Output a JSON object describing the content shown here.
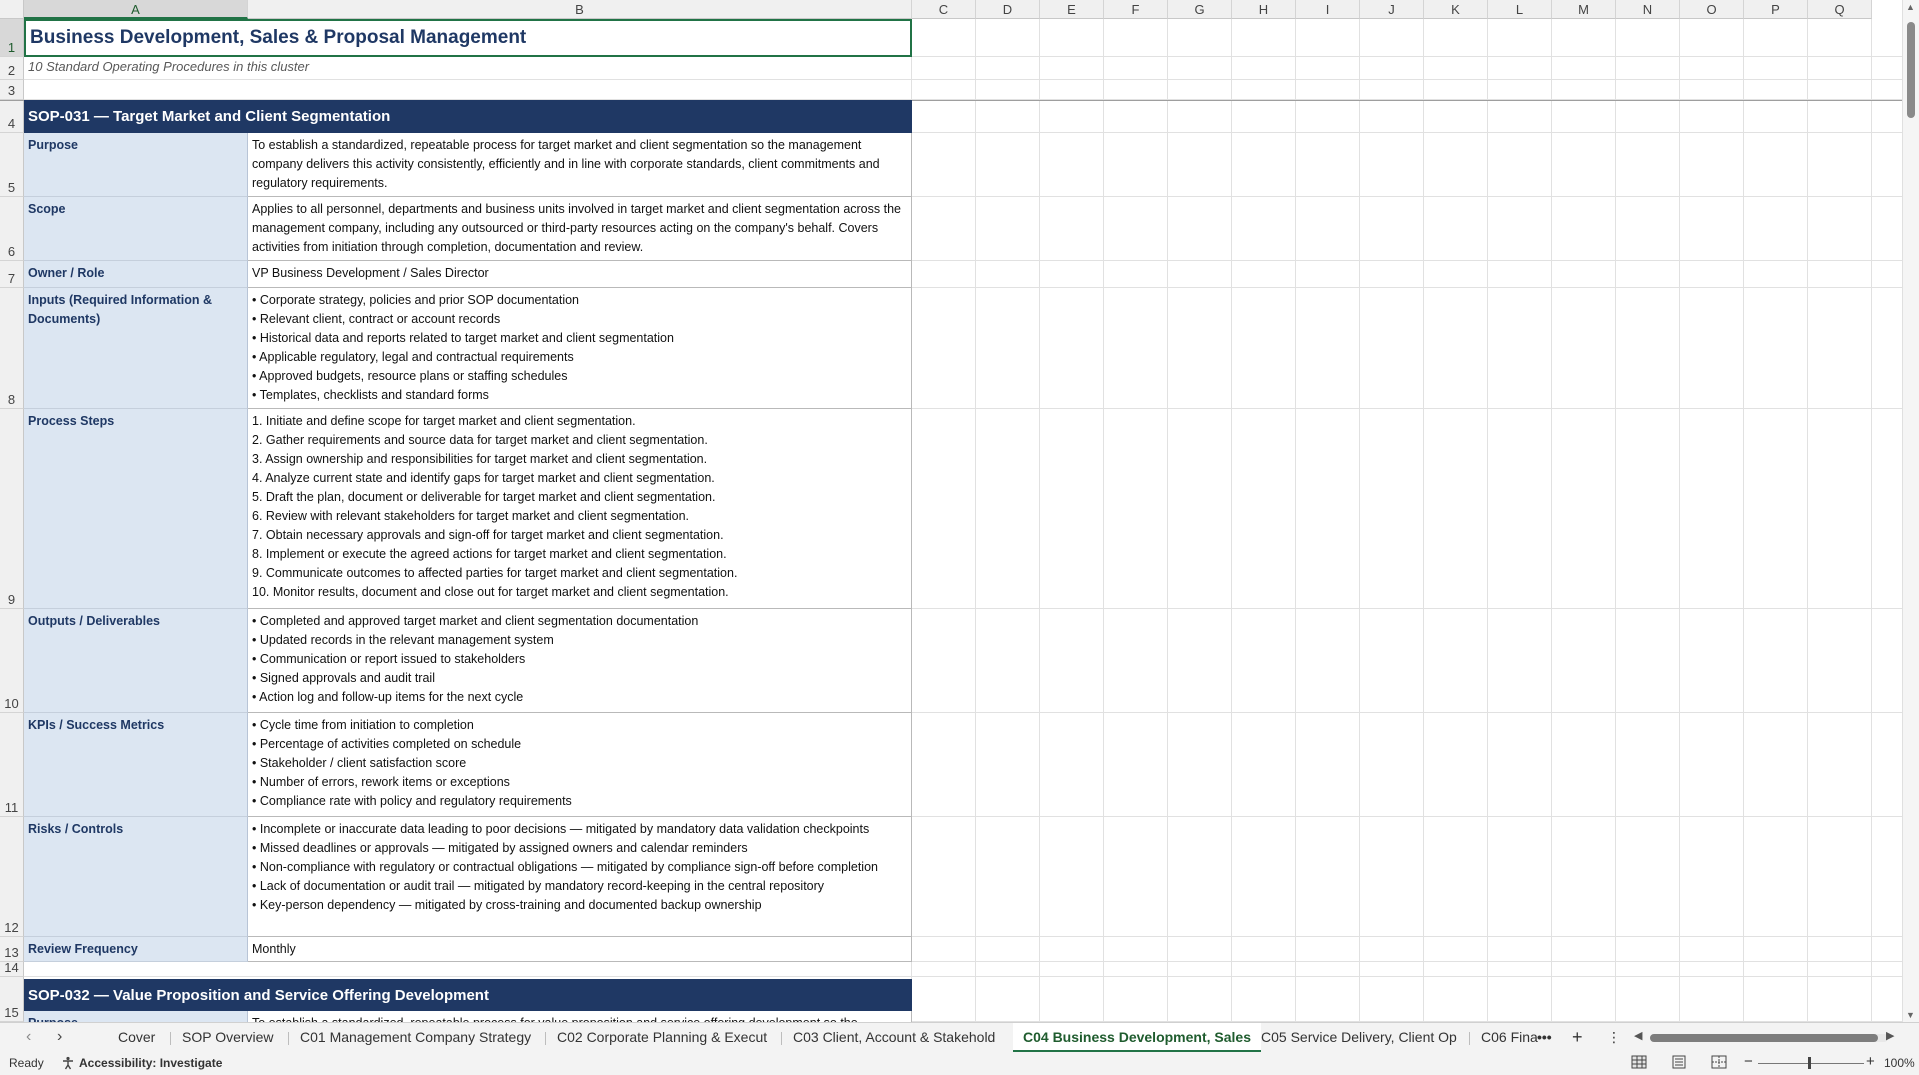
{
  "columns": [
    "A",
    "B",
    "C",
    "D",
    "E",
    "F",
    "G",
    "H",
    "I",
    "J",
    "K",
    "L",
    "M",
    "N",
    "O",
    "P",
    "Q"
  ],
  "rows": [
    "1",
    "2",
    "3",
    "4",
    "5",
    "6",
    "7",
    "8",
    "9",
    "10",
    "11",
    "12",
    "13",
    "14",
    "15"
  ],
  "sheet": {
    "title": "Business Development, Sales & Proposal Management",
    "subtitle": "10 Standard Operating Procedures in this cluster",
    "sop1": {
      "header": "SOP-031  —  Target Market and Client Segmentation",
      "fields": [
        {
          "label": "Purpose",
          "value": "To establish a standardized, repeatable process for target market and client segmentation so the management company delivers this activity consistently, efficiently and in line with corporate standards, client commitments and regulatory requirements."
        },
        {
          "label": "Scope",
          "value": "Applies to all personnel, departments and business units involved in target market and client segmentation across the management company, including any outsourced or third-party resources acting on the company's behalf. Covers activities from initiation through completion, documentation and review."
        },
        {
          "label": "Owner / Role",
          "value": "VP Business Development / Sales Director"
        },
        {
          "label": "Inputs (Required Information & Documents)",
          "value": "• Corporate strategy, policies and prior SOP documentation\n• Relevant client, contract or account records\n• Historical data and reports related to target market and client segmentation\n• Applicable regulatory, legal and contractual requirements\n• Approved budgets, resource plans or staffing schedules\n• Templates, checklists and standard forms"
        },
        {
          "label": "Process Steps",
          "value": "1. Initiate and define scope for target market and client segmentation.\n2. Gather requirements and source data for target market and client segmentation.\n3. Assign ownership and responsibilities for target market and client segmentation.\n4. Analyze current state and identify gaps for target market and client segmentation.\n5. Draft the plan, document or deliverable for target market and client segmentation.\n6. Review with relevant stakeholders for target market and client segmentation.\n7. Obtain necessary approvals and sign-off for target market and client segmentation.\n8. Implement or execute the agreed actions for target market and client segmentation.\n9. Communicate outcomes to affected parties for target market and client segmentation.\n10. Monitor results, document and close out for target market and client segmentation."
        },
        {
          "label": "Outputs / Deliverables",
          "value": "• Completed and approved target market and client segmentation documentation\n• Updated records in the relevant management system\n• Communication or report issued to stakeholders\n• Signed approvals and audit trail\n• Action log and follow-up items for the next cycle"
        },
        {
          "label": "KPIs / Success Metrics",
          "value": "• Cycle time from initiation to completion\n• Percentage of activities completed on schedule\n• Stakeholder / client satisfaction score\n• Number of errors, rework items or exceptions\n• Compliance rate with policy and regulatory requirements"
        },
        {
          "label": "Risks / Controls",
          "value": "• Incomplete or inaccurate data leading to poor decisions — mitigated by mandatory data validation checkpoints\n• Missed deadlines or approvals — mitigated by assigned owners and calendar reminders\n• Non-compliance with regulatory or contractual obligations — mitigated by compliance sign-off before completion\n• Lack of documentation or audit trail — mitigated by mandatory record-keeping in the central repository\n• Key-person dependency — mitigated by cross-training and documented backup ownership"
        },
        {
          "label": "Review Frequency",
          "value": "Monthly"
        }
      ]
    },
    "sop2": {
      "header": "SOP-032  —  Value Proposition and Service Offering Development",
      "first_label": "Purpose",
      "first_value": "To establish a standardized, repeatable process for value proposition and service offering development so the"
    }
  },
  "tabs": [
    "Cover",
    "SOP Overview",
    "C01 Management Company Strategy",
    "C02 Corporate Planning & Execut",
    "C03 Client, Account & Stakehold",
    "C04 Business Development, Sales",
    "C05 Service Delivery, Client Op",
    "C06 Fina"
  ],
  "active_tab": "C04 Business Development, Sales",
  "tab_more": "•••",
  "tab_add": "+",
  "tab_options": "⋮",
  "status": {
    "ready": "Ready",
    "accessibility": "Accessibility: Investigate",
    "zoom": "100%",
    "zoom_minus": "−",
    "zoom_plus": "+"
  },
  "icons": {
    "prev_sheet": "chevron-left-icon",
    "next_sheet": "chevron-right-icon",
    "accessibility": "accessibility-icon",
    "normal_view": "grid-view-icon",
    "page_layout": "page-layout-icon",
    "page_break": "page-break-icon"
  },
  "colors": {
    "header_navy": "#1f3864",
    "label_bg": "#dce6f2",
    "excel_green": "#217346"
  }
}
